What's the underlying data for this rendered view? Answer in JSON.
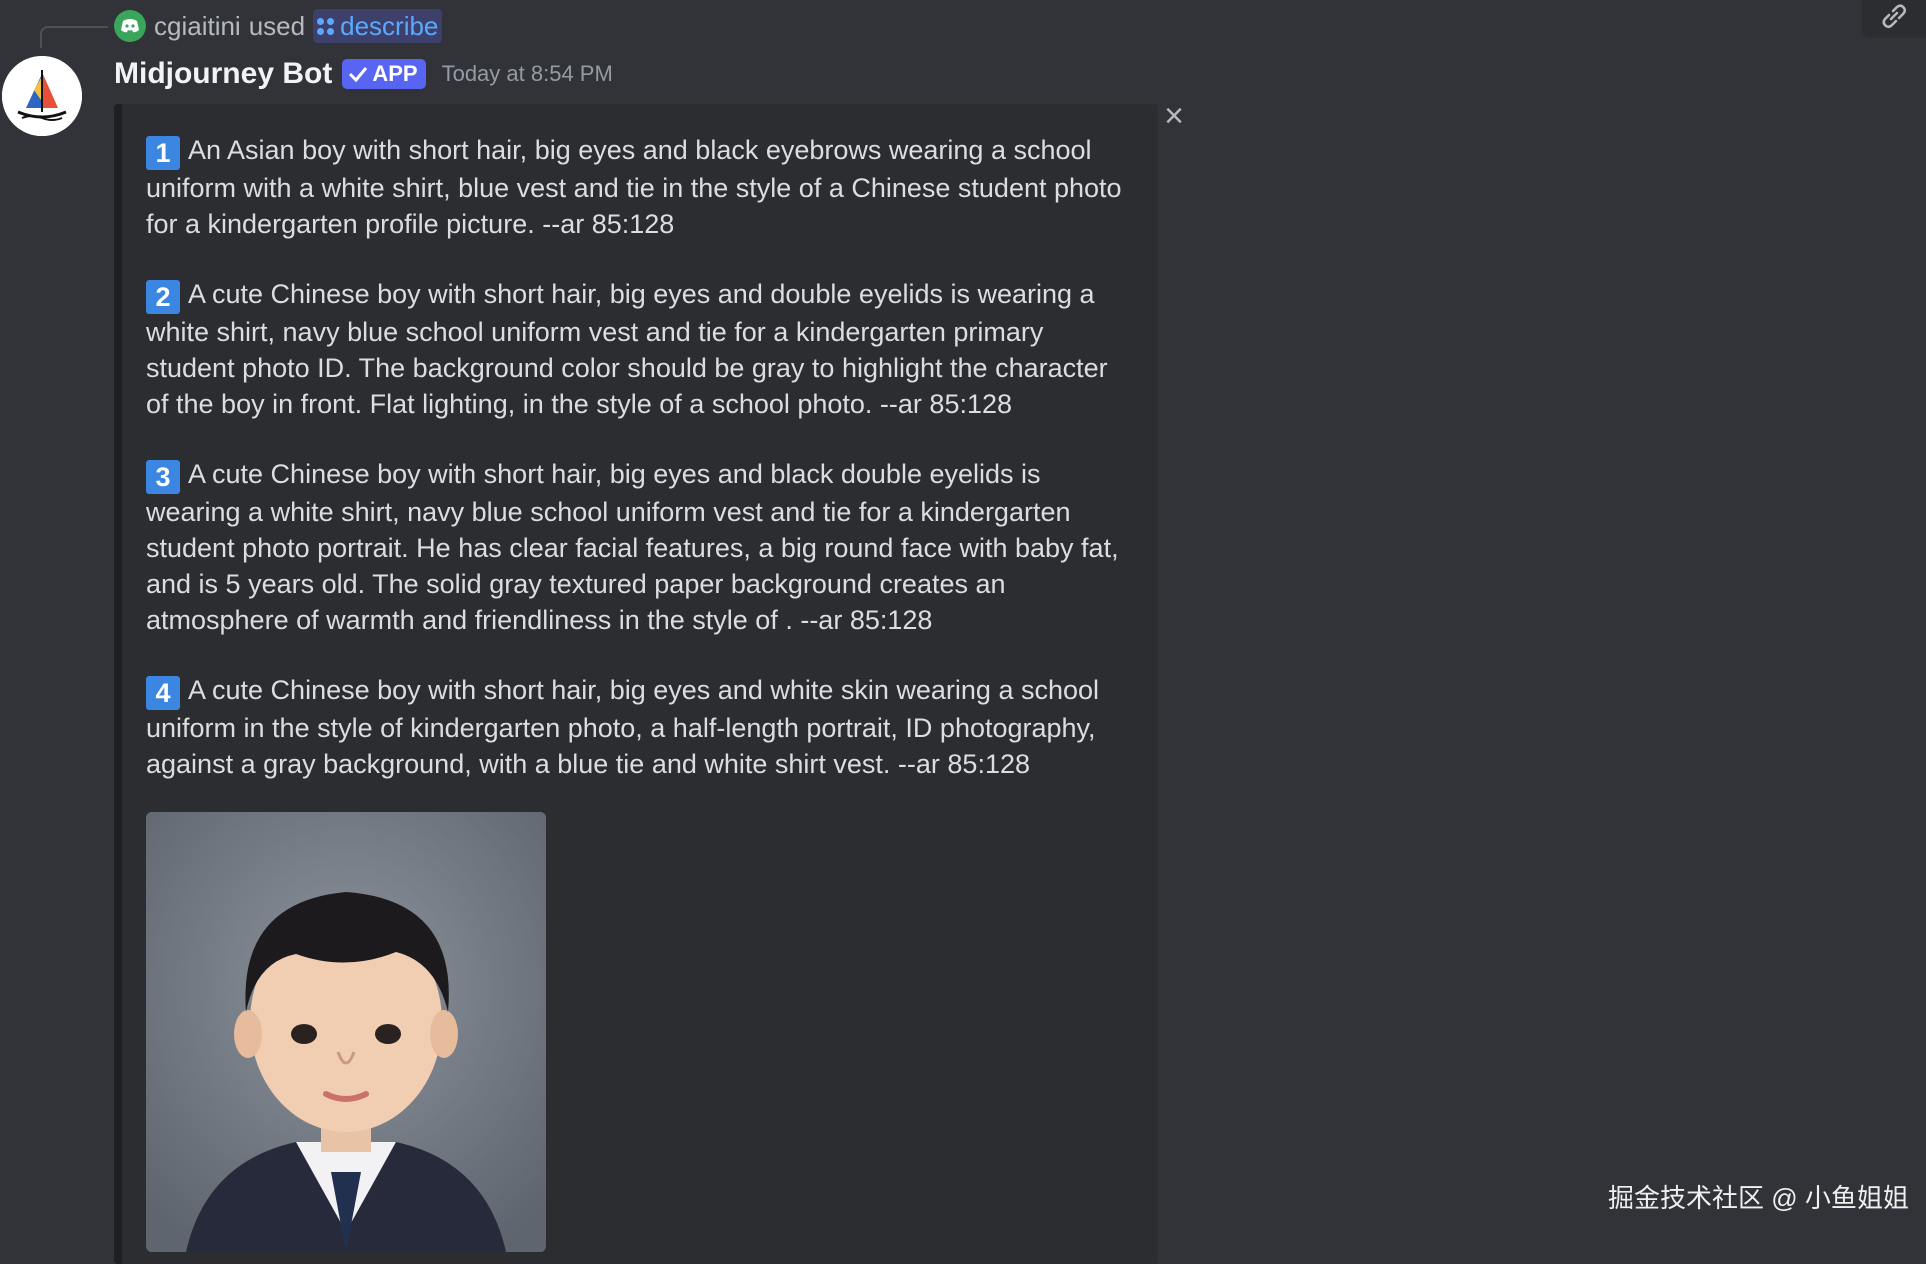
{
  "reply": {
    "user": "cgiaitini",
    "used_text": "used",
    "command": "describe"
  },
  "message": {
    "author": "Midjourney Bot",
    "badge": "APP",
    "timestamp": "Today at 8:54 PM"
  },
  "descriptions": [
    {
      "number": "1",
      "text": "An Asian boy with short hair, big eyes and black eyebrows wearing a school uniform with a white shirt, blue vest and tie in the style of a Chinese student photo for a kindergarten profile picture. --ar 85:128"
    },
    {
      "number": "2",
      "text": "A cute Chinese boy with short hair, big eyes and double eyelids is wearing a white shirt, navy blue school uniform vest and tie for a kindergarten primary student photo ID. The background color should be gray to highlight the character of the boy in front. Flat lighting, in the style of a school photo. --ar 85:128"
    },
    {
      "number": "3",
      "text": "A cute Chinese boy with short hair, big eyes and black double eyelids is wearing a white shirt, navy blue school uniform vest and tie for a kindergarten student photo portrait. He has clear facial features, a big round face with baby fat, and is 5 years old. The solid gray textured paper background creates an atmosphere of warmth and friendliness in the style of . --ar 85:128"
    },
    {
      "number": "4",
      "text": "A cute Chinese boy with short hair, big eyes and white skin wearing a school uniform in the style of kindergarten photo, a half-length portrait, ID photography, against a gray background, with a blue tie and white shirt vest. --ar 85:128"
    }
  ],
  "watermark": "掘金技术社区 @ 小鱼姐姐",
  "colors": {
    "background": "#313338",
    "embed": "#2b2d31",
    "accent": "#5865f2",
    "number_badge": "#3a86e0",
    "link": "#5aa9ff"
  },
  "icons": [
    "discord-icon",
    "slash-command-icon",
    "check-icon",
    "close-icon",
    "link-icon"
  ]
}
